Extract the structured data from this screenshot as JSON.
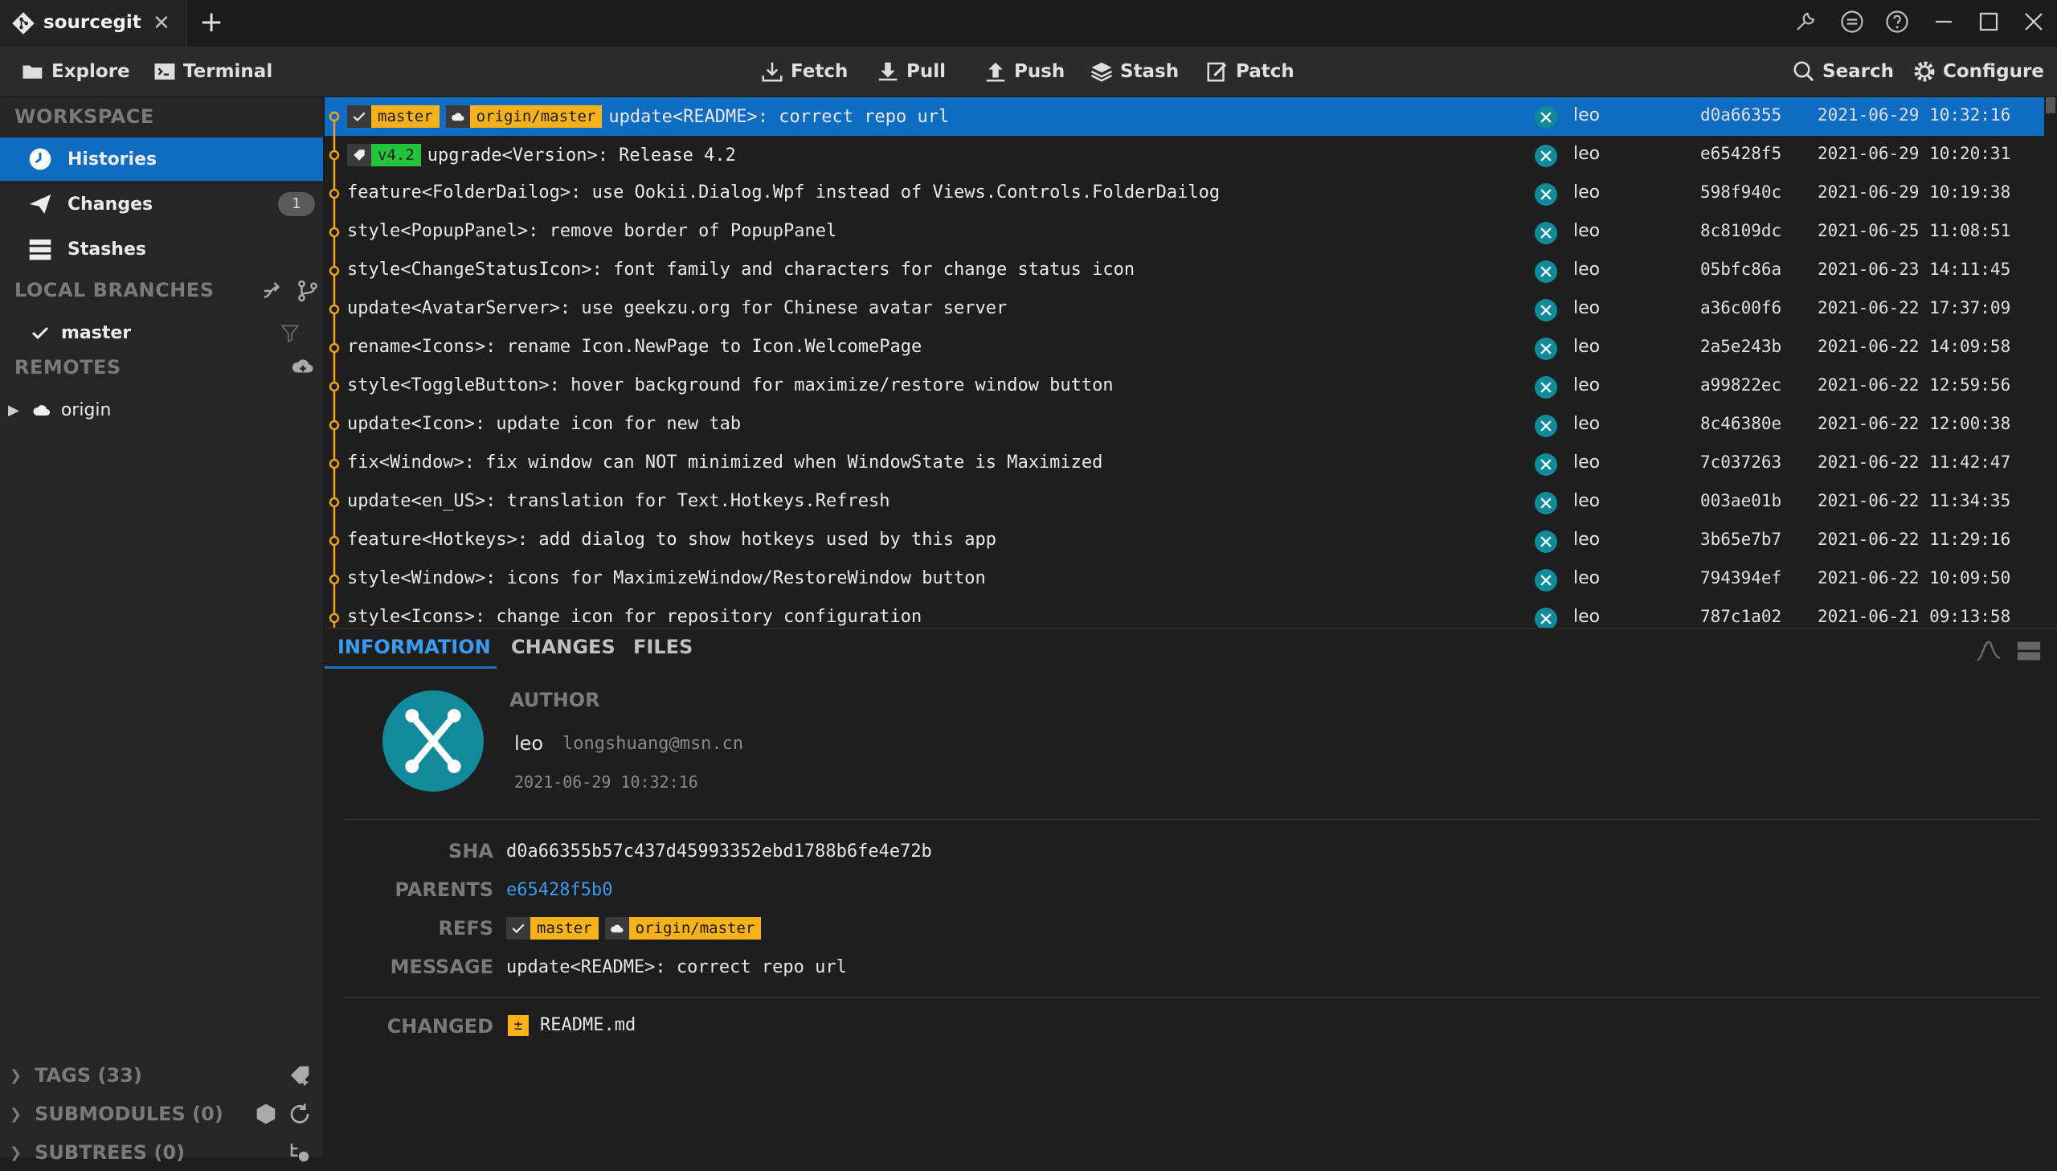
{
  "titlebar": {
    "tab_title": "sourcegit",
    "close_glyph": "✕",
    "new_tab_glyph": "+"
  },
  "toolbar": {
    "explore": "Explore",
    "terminal": "Terminal",
    "fetch": "Fetch",
    "pull": "Pull",
    "push": "Push",
    "stash": "Stash",
    "patch": "Patch",
    "search": "Search",
    "configure": "Configure"
  },
  "sidebar": {
    "workspace": "WORKSPACE",
    "histories": "Histories",
    "changes": "Changes",
    "changes_count": "1",
    "stashes": "Stashes",
    "local_branches": "LOCAL BRANCHES",
    "branch": "master",
    "remotes": "REMOTES",
    "remote": "origin",
    "tags": "TAGS (33)",
    "submodules": "SUBMODULES (0)",
    "subtrees": "SUBTREES (0)"
  },
  "commits": [
    {
      "refs": [
        {
          "kind": "branch",
          "name": "master"
        },
        {
          "kind": "remote",
          "name": "origin/master"
        }
      ],
      "message": "update<README>: correct repo url",
      "author": "leo",
      "sha": "d0a66355",
      "date": "2021-06-29 10:32:16"
    },
    {
      "refs": [
        {
          "kind": "tag",
          "name": "v4.2"
        }
      ],
      "message": "upgrade<Version>: Release 4.2",
      "author": "leo",
      "sha": "e65428f5",
      "date": "2021-06-29 10:20:31"
    },
    {
      "refs": [],
      "message": "feature<FolderDailog>: use Ookii.Dialog.Wpf instead of Views.Controls.FolderDailog",
      "author": "leo",
      "sha": "598f940c",
      "date": "2021-06-29 10:19:38"
    },
    {
      "refs": [],
      "message": "style<PopupPanel>: remove border of PopupPanel",
      "author": "leo",
      "sha": "8c8109dc",
      "date": "2021-06-25 11:08:51"
    },
    {
      "refs": [],
      "message": "style<ChangeStatusIcon>: font family and characters for change status icon",
      "author": "leo",
      "sha": "05bfc86a",
      "date": "2021-06-23 14:11:45"
    },
    {
      "refs": [],
      "message": "update<AvatarServer>: use geekzu.org for Chinese avatar server",
      "author": "leo",
      "sha": "a36c00f6",
      "date": "2021-06-22 17:37:09"
    },
    {
      "refs": [],
      "message": "rename<Icons>: rename Icon.NewPage to Icon.WelcomePage",
      "author": "leo",
      "sha": "2a5e243b",
      "date": "2021-06-22 14:09:58"
    },
    {
      "refs": [],
      "message": "style<ToggleButton>: hover background for maximize/restore window button",
      "author": "leo",
      "sha": "a99822ec",
      "date": "2021-06-22 12:59:56"
    },
    {
      "refs": [],
      "message": "update<Icon>: update icon for new tab",
      "author": "leo",
      "sha": "8c46380e",
      "date": "2021-06-22 12:00:38"
    },
    {
      "refs": [],
      "message": "fix<Window>: fix window can NOT minimized when WindowState is Maximized",
      "author": "leo",
      "sha": "7c037263",
      "date": "2021-06-22 11:42:47"
    },
    {
      "refs": [],
      "message": "update<en_US>: translation for Text.Hotkeys.Refresh",
      "author": "leo",
      "sha": "003ae01b",
      "date": "2021-06-22 11:34:35"
    },
    {
      "refs": [],
      "message": "feature<Hotkeys>: add dialog to show hotkeys used by this app",
      "author": "leo",
      "sha": "3b65e7b7",
      "date": "2021-06-22 11:29:16"
    },
    {
      "refs": [],
      "message": "style<Window>: icons for MaximizeWindow/RestoreWindow button",
      "author": "leo",
      "sha": "794394ef",
      "date": "2021-06-22 10:09:50"
    },
    {
      "refs": [],
      "message": "style<Icons>: change icon for repository configuration",
      "author": "leo",
      "sha": "787c1a02",
      "date": "2021-06-21 09:13:58"
    }
  ],
  "details": {
    "tabs": [
      "INFORMATION",
      "CHANGES",
      "FILES"
    ],
    "author_label": "AUTHOR",
    "author_name": "leo",
    "author_email": "longshuang@msn.cn",
    "author_date": "2021-06-29 10:32:16",
    "sha_label": "SHA",
    "sha": "d0a66355b57c437d45993352ebd1788b6fe4e72b",
    "parents_label": "PARENTS",
    "parent": "e65428f5b0",
    "refs_label": "REFS",
    "ref_branch": "master",
    "ref_remote": "origin/master",
    "message_label": "MESSAGE",
    "message": "update<README>: correct repo url",
    "changed_label": "CHANGED",
    "changed_status": "±",
    "changed_file": "README.md"
  },
  "colors": {
    "accent": "#0e6dc2",
    "ref": "#f7b21a",
    "tag": "#23c43a",
    "avatar": "#118a9b",
    "graph": "#f0a21a"
  }
}
